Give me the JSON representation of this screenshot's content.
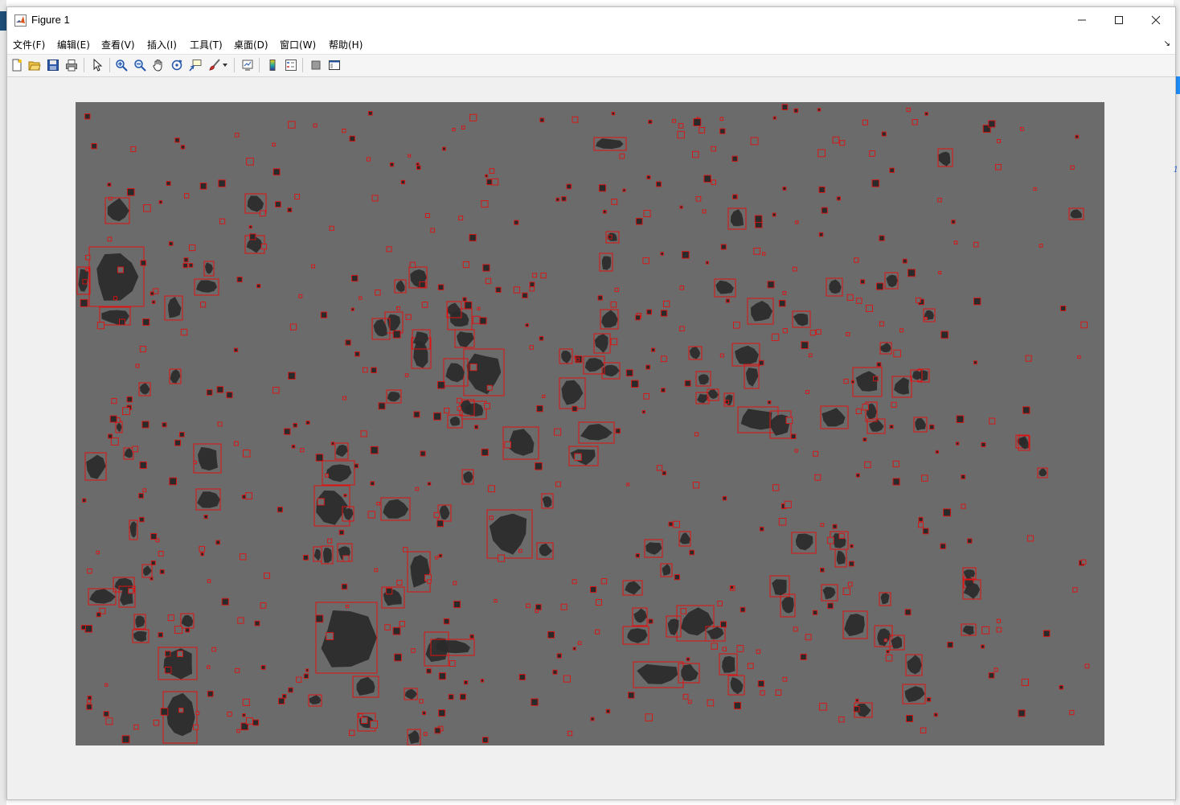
{
  "window": {
    "title": "Figure 1",
    "controls": [
      "minimize",
      "maximize",
      "close"
    ]
  },
  "menubar": {
    "items": [
      {
        "label": "文件(F)"
      },
      {
        "label": "编辑(E)"
      },
      {
        "label": "查看(V)"
      },
      {
        "label": "插入(I)"
      },
      {
        "label": "工具(T)"
      },
      {
        "label": "桌面(D)"
      },
      {
        "label": "窗口(W)"
      },
      {
        "label": "帮助(H)"
      }
    ]
  },
  "toolbar": {
    "tools": [
      "new-figure-icon",
      "open-file-icon",
      "save-icon",
      "print-icon",
      "edit-plot-arrow-icon",
      "zoom-in-icon",
      "zoom-out-icon",
      "pan-hand-icon",
      "rotate-3d-icon",
      "data-cursor-icon",
      "brush-icon",
      "link-plot-icon",
      "insert-colorbar-icon",
      "insert-legend-icon",
      "hide-plot-tools-icon",
      "show-plot-tools-icon"
    ]
  },
  "image": {
    "background_color": "#6b6b6b",
    "particle_color": "#2a2a2a",
    "box_color": "#e01010"
  },
  "colors": {
    "accent": "#e01010",
    "window_bg": "#f0f0f0"
  }
}
